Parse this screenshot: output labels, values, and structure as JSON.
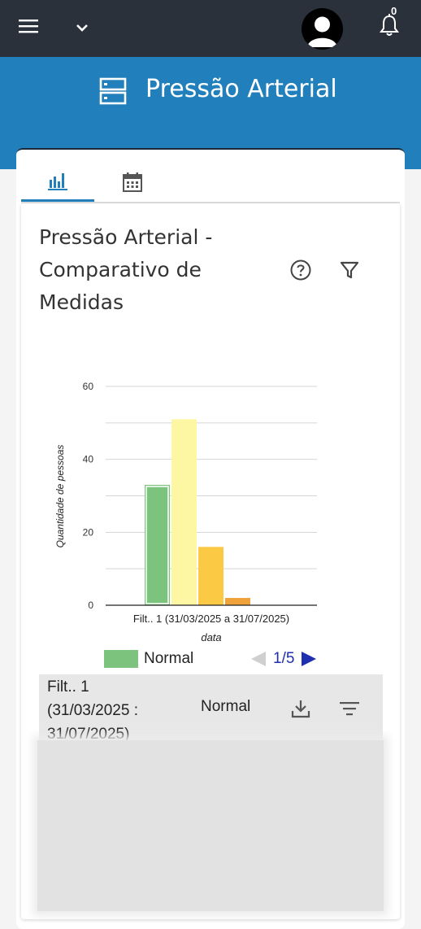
{
  "topbar": {
    "menu_icon": "hamburger-icon",
    "dropdown_icon": "chevron-down-icon",
    "avatar_icon": "user-avatar-icon",
    "notification_count": "0",
    "bg_color": "#2b313b"
  },
  "header": {
    "title": "Pressão Arterial",
    "icon": "storage-icon",
    "bg_color": "#2180bb"
  },
  "tabs": [
    {
      "icon": "bar-chart-icon",
      "active": true
    },
    {
      "icon": "calendar-icon",
      "active": false
    }
  ],
  "chart_card": {
    "title": "Pressão Arterial - Comparativo de Medidas",
    "help_icon": "help-circle-icon",
    "filter_icon": "filter-icon"
  },
  "chart_data": {
    "type": "bar",
    "xlabel": "data",
    "ylabel": "Quantidade de pessoas",
    "category_label": "Filt.. 1 (31/03/2025 a 31/07/2025)",
    "ylim": [
      0,
      60
    ],
    "yticks": [
      "0",
      "20",
      "40",
      "60"
    ],
    "series": [
      {
        "name": "Normal",
        "value": 33,
        "color": "#7cc47e"
      },
      {
        "value": 51,
        "color": "#fdf6a3"
      },
      {
        "value": 16,
        "color": "#fcc944"
      },
      {
        "value": 2,
        "color": "#f0a23a"
      }
    ],
    "grid": true
  },
  "legend": {
    "label": "Normal",
    "color": "#7cc47e"
  },
  "pager": {
    "text": "1/5"
  },
  "table": {
    "filter_lines": [
      "Filt.. 1",
      "(31/03/2025 :",
      "31/07/2025)"
    ],
    "category": "Normal",
    "download_icon": "download-icon",
    "sort_icon": "sort-lines-icon"
  }
}
